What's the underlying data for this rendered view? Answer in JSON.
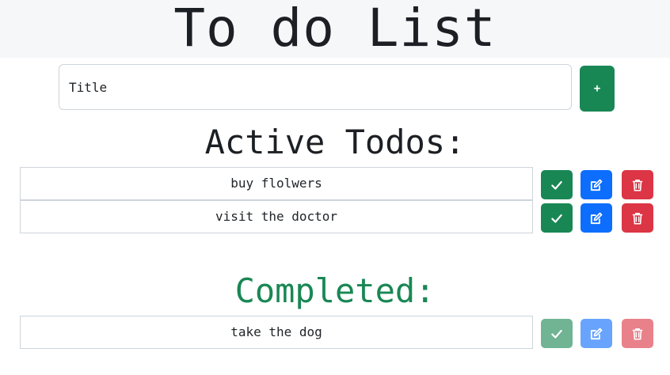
{
  "header": {
    "title": "To do List"
  },
  "new_todo": {
    "placeholder": "Title",
    "add_label": "+"
  },
  "active": {
    "title": "Active Todos:",
    "items": [
      {
        "text": "buy flolwers"
      },
      {
        "text": "visit the doctor"
      }
    ]
  },
  "completed": {
    "title": "Completed:",
    "items": [
      {
        "text": "take the dog"
      }
    ]
  },
  "icons": {
    "done": "check-icon",
    "edit": "edit-icon",
    "delete": "trash-icon"
  },
  "colors": {
    "success": "#198754",
    "primary": "#0d6efd",
    "danger": "#dc3545",
    "header_bg": "#f6f7f9"
  }
}
